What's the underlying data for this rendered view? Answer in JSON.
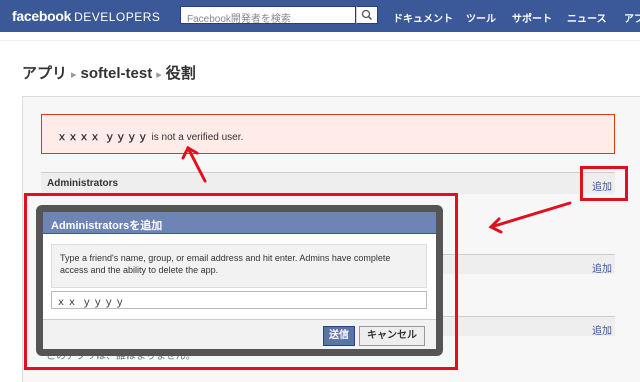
{
  "topbar": {
    "logo": "facebook",
    "logo_suffix": "DEVELOPERS",
    "search_placeholder": "Facebook開発者を検索",
    "nav": [
      "ドキュメント",
      "ツール",
      "サポート",
      "ニュース",
      "アプ"
    ]
  },
  "breadcrumb": {
    "app": "アプリ",
    "separator": "▸",
    "name": "softel-test",
    "page": "役割"
  },
  "error": {
    "user": "ｘｘｘｘ ｙｙｙｙ",
    "message": " is not a verified user."
  },
  "sections": {
    "administrators": "Administrators",
    "add_label": "追加"
  },
  "dialog": {
    "title": "Administratorsを追加",
    "description": "Type a friend's name, group, or email address and hit enter. Admins have complete access and the ability to delete the app.",
    "input_value": "ｘｘ ｙｙｙｙ",
    "send": "送信",
    "cancel": "キャンセル"
  },
  "under_text": "このアプリは、誰ほまりません。",
  "colors": {
    "brand": "#3b5998",
    "annotation": "#e0101e",
    "error_bg": "#ffebe8"
  }
}
